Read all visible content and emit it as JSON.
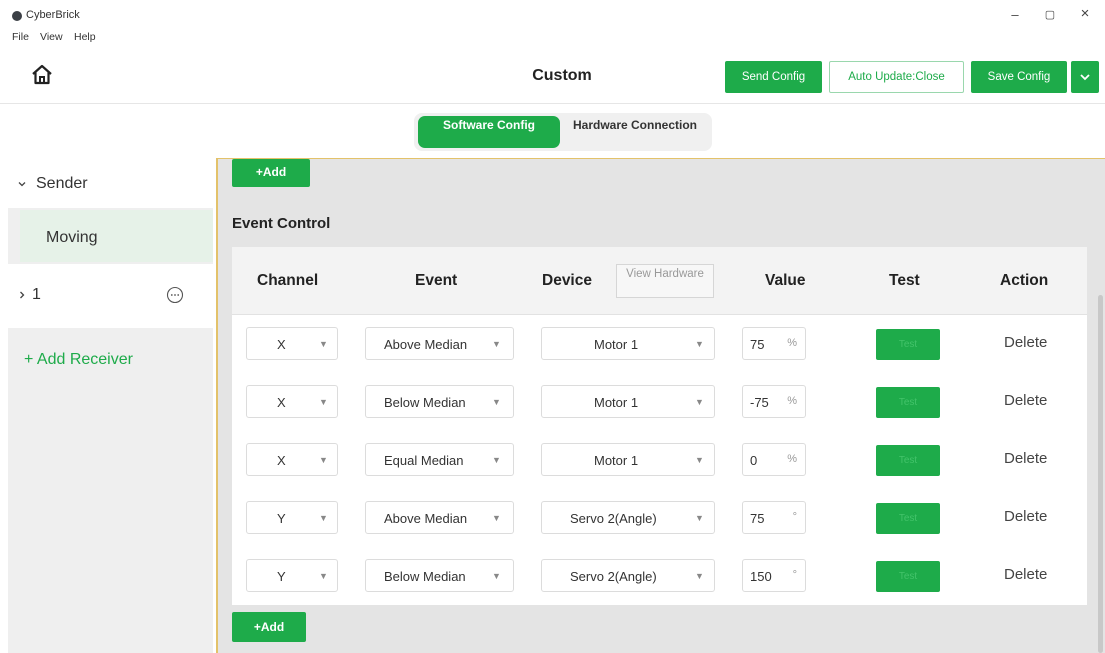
{
  "window": {
    "title": "CyberBrick",
    "controls": {
      "minimize": "–",
      "maximize": "▢",
      "close": "×"
    }
  },
  "menu": [
    "File",
    "View",
    "Help"
  ],
  "header": {
    "title": "Custom",
    "send_config": "Send Config",
    "auto_update": "Auto Update:Close",
    "save_config": "Save Config",
    "dropdown_icon": "chevron-down-icon"
  },
  "toggle": {
    "software": "Software Config",
    "hardware": "Hardware Connection"
  },
  "sidebar": {
    "sender_label": "Sender",
    "moving_label": "Moving",
    "receiver_label": "1",
    "add_receiver": "+ Add Receiver"
  },
  "main": {
    "add_label": "+Add",
    "section_title": "Event Control",
    "columns": {
      "channel": "Channel",
      "event": "Event",
      "device": "Device",
      "value": "Value",
      "test": "Test",
      "action": "Action"
    },
    "view_hardware": "View Hardware",
    "rows": [
      {
        "channel": "X",
        "event": "Above Median",
        "device": "Motor 1",
        "value": "75",
        "unit": "%",
        "test": "Test",
        "action": "Delete"
      },
      {
        "channel": "X",
        "event": "Below Median",
        "device": "Motor 1",
        "value": "-75",
        "unit": "%",
        "test": "Test",
        "action": "Delete"
      },
      {
        "channel": "X",
        "event": "Equal Median",
        "device": "Motor 1",
        "value": "0",
        "unit": "%",
        "test": "Test",
        "action": "Delete"
      },
      {
        "channel": "Y",
        "event": "Above Median",
        "device": "Servo 2(Angle)",
        "value": "75",
        "unit": "°",
        "test": "Test",
        "action": "Delete"
      },
      {
        "channel": "Y",
        "event": "Below Median",
        "device": "Servo 2(Angle)",
        "value": "150",
        "unit": "°",
        "test": "Test",
        "action": "Delete"
      }
    ]
  },
  "colors": {
    "accent": "#1eab4a",
    "selected_bg": "#e6f2e8",
    "border_accent": "#e3c26a"
  }
}
